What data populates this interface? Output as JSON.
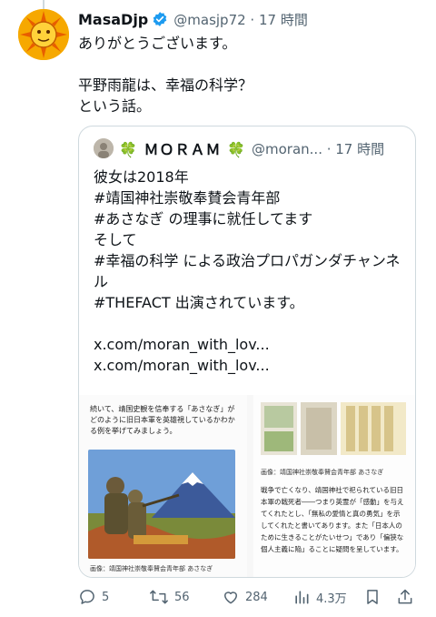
{
  "tweet": {
    "display_name": "MasaDjp",
    "handle_time": "@masjp72 · 17 時間",
    "lines": [
      "ありがとうございます。",
      "",
      "平野雨龍は、幸福の科学？",
      "という話。"
    ]
  },
  "quote": {
    "display_name": "🍀 ＭＯＲＡＭ 🍀",
    "handle_time": "@moran... · 17 時間",
    "lines": [
      "彼女は2018年",
      "#靖国神社崇敬奉賛会青年部",
      "#あさなぎ の理事に就任してます",
      "そして",
      "#幸福の科学 による政治プロパガンダチャンネル",
      "#THEFACT  出演されています。",
      "",
      "x.com/moran_with_lov... x.com/moran_with_lov..."
    ],
    "media": {
      "doc_text": "続いて、靖国史観を信奉する「あさなぎ」がどのように旧日本軍を英雄視しているかわかる例を挙げてみましょう。",
      "caption_left": "画像：靖国神社崇敬奉賛会青年部 あさなぎ",
      "caption_right": "画像：靖国神社崇敬奉賛会青年部 あさなぎ",
      "right_text": "戦争で亡くなり、靖国神社で祀られている旧日本軍の戦死者――つまり英霊が「感動」を与えてくれたとし、「無私の愛情と真の勇気」を示してくれたと書いてあります。また「日本人のために生きることがたいせつ」であり「偏狭な個人主義に陥」ることに疑問を呈しています。"
    }
  },
  "actions": {
    "replies": "5",
    "reposts": "56",
    "likes": "284",
    "views": "4.3万"
  },
  "icons": [
    "sun-avatar",
    "verified-badge-icon",
    "reply-icon",
    "repost-icon",
    "like-icon",
    "views-icon",
    "bookmark-icon",
    "share-icon"
  ],
  "colors": {
    "verified": "#1d9bf0",
    "muted": "#536471",
    "border": "#cfd9de"
  }
}
